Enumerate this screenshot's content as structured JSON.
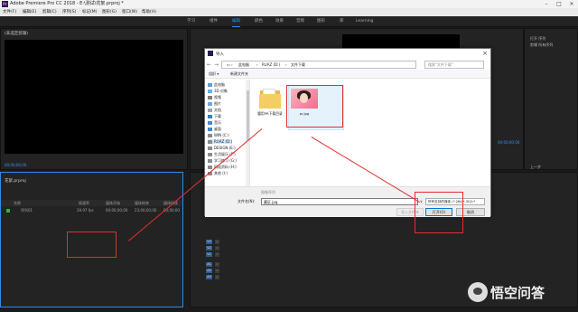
{
  "window": {
    "title": "Adobe Premiere Pro CC 2018 - E:\\测试\\花絮.prproj *"
  },
  "menu": [
    "文件(F)",
    "编辑(E)",
    "剪辑(C)",
    "序列(S)",
    "标记(M)",
    "图形(G)",
    "窗口(W)",
    "帮助(H)"
  ],
  "workspaces": {
    "tabs": [
      "学习",
      "组件",
      "编辑",
      "颜色",
      "效果",
      "音频",
      "图形",
      "库",
      "Learning"
    ],
    "active_index": 2
  },
  "panels": {
    "source_tab": "(未选定剪辑)",
    "effects_tab": "效果控件",
    "program_timecode_left": "00:00:00:00",
    "program_timecode_right": "00:00:00:00",
    "source_timecode": "00;00;00;00",
    "right_panel_items": [
      "打开 序列",
      "剪辑 所有序列"
    ],
    "right_hint": "上一步"
  },
  "project": {
    "tab": "花絮.prproj",
    "columns": [
      "名称",
      "帧速率",
      "媒体开始",
      "媒体结束",
      "媒体持续"
    ],
    "rows": [
      {
        "name": "序列01",
        "fps": "29.97 fps",
        "start": "00;00;00;00",
        "end": "23;00;00;00",
        "dur": "00;00;00"
      }
    ]
  },
  "timeline": {
    "timecode_left": "00;00;00;00",
    "timecode_right": "00;00;32;00",
    "video_tracks": [
      "V3",
      "V2",
      "V1"
    ],
    "audio_tracks": [
      "A1",
      "A2",
      "A3"
    ]
  },
  "dialog": {
    "title": "导入",
    "breadcrumb": [
      "此电脑",
      "RUAZ (D:)",
      "文件下载"
    ],
    "search_placeholder": "搜索\"文件下载\"",
    "organize_label": "组织 ▾",
    "new_folder_label": "新建文件夹",
    "nav_items": [
      "此电脑",
      "3D 对象",
      "视频",
      "图片",
      "文档",
      "下载",
      "音乐",
      "桌面",
      "WIN (C:)",
      "RUAZ (D:)",
      "DESIGN (E:)",
      "生活娱乐 (F:)",
      "学习练习 (G:)",
      "网站资料 (H:)",
      "其他 (I:)"
    ],
    "files": [
      {
        "name": "魔用PR下载目录",
        "type": "folder"
      },
      {
        "name": "pr.jpg",
        "type": "image"
      }
    ],
    "image_sequence_label": "图像序列",
    "filename_label": "文件名(N):",
    "filename_value": "藏区.jpg",
    "filetype_value": "所有支持的媒体 (*.264;*.3G2;*",
    "import_folder_label": "导入文件夹",
    "open_label": "打开(O)",
    "cancel_label": "取消"
  },
  "watermark": {
    "text": "悟空问答"
  },
  "colors": {
    "annotation": "#e52d2d",
    "premiere_accent": "#2d8ceb"
  }
}
